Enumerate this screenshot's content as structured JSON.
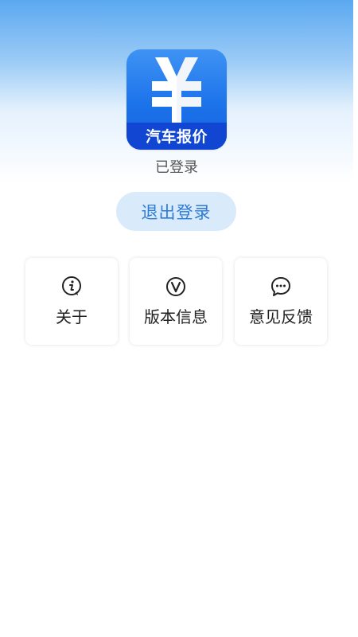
{
  "app": {
    "icon_label": "汽车报价",
    "icon_symbol": "yen-icon",
    "status": "已登录"
  },
  "actions": {
    "logout_label": "退出登录"
  },
  "cards": [
    {
      "label": "关于",
      "icon": "info-icon"
    },
    {
      "label": "版本信息",
      "icon": "version-icon"
    },
    {
      "label": "意见反馈",
      "icon": "chat-bubble-icon"
    }
  ],
  "colors": {
    "accent": "#2d7bd6",
    "button_bg": "#d9ebfb",
    "icon_blue": "#1c73ea",
    "icon_band": "#1046d2"
  }
}
